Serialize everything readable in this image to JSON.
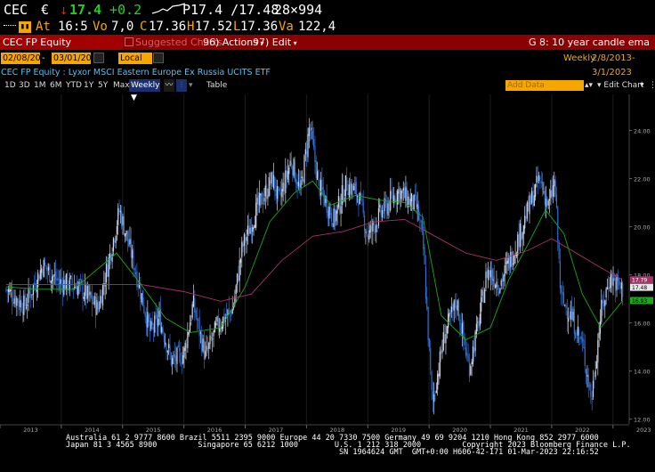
{
  "quote": {
    "ticker": "CEC",
    "currency_symbol": "€",
    "arrow": "↓",
    "last": "17.4",
    "change": "+0.2",
    "bidask": "P17.4 /17.48",
    "size": "28×994",
    "time_label": "At",
    "time": "16:5",
    "vol_label": "Vo",
    "vol": "7,0",
    "open_label": "C",
    "open": "17.36",
    "high_label": "H",
    "high": "17.52",
    "low_label": "L",
    "low": "17.36",
    "val_label": "Va",
    "val": "122,4"
  },
  "toolbar": {
    "security": "CEC FP Equity",
    "suggested": "Suggested Charts",
    "actions": "96) Actions",
    "edit": "97) Edit",
    "function": "G 8: 10 year candle ema"
  },
  "daterow": {
    "start": "02/08/2013",
    "end": "03/01/2023",
    "currency": "Local CCY",
    "period": "Weekly",
    "range": "2/8/2013-3/1/2023"
  },
  "titlerow": {
    "title": "CEC FP Equity : Lyxor MSCI Eastern Europe Ex Russia UCITS ETF",
    "add_data": "Add Data",
    "edit_chart": "Edit Chart"
  },
  "controls": [
    "1D",
    "3D",
    "1M",
    "6M",
    "YTD",
    "1Y",
    "5Y",
    "Max",
    "Weekly ▼",
    "Table"
  ],
  "colors": {
    "accent_orange": "#f7a600",
    "toolbar_red": "#8b0000",
    "candle_up": "#cfd8ea",
    "candle_down": "#2e6fd8",
    "ema_short": "#1aa81a",
    "ema_long": "#a8326a"
  },
  "chart_data": {
    "type": "candlestick",
    "x_axis": [
      "2013",
      "2014",
      "2015",
      "2016",
      "2017",
      "2018",
      "2019",
      "2020",
      "2021",
      "2022",
      "2023"
    ],
    "y_ticks": [
      "12.00",
      "14.00",
      "16.00",
      "18.00",
      "20.00",
      "22.00",
      "24.00"
    ],
    "ylim": [
      11.8,
      25.5
    ],
    "price_path": [
      [
        2013.1,
        17.4
      ],
      [
        2013.4,
        16.7
      ],
      [
        2013.7,
        18.4
      ],
      [
        2013.95,
        17.7
      ],
      [
        2014.3,
        17.5
      ],
      [
        2014.6,
        16.6
      ],
      [
        2014.8,
        18.9
      ],
      [
        2014.95,
        20.7
      ],
      [
        2015.2,
        18.3
      ],
      [
        2015.45,
        15.6
      ],
      [
        2015.6,
        16.2
      ],
      [
        2015.8,
        14.4
      ],
      [
        2016.0,
        14.7
      ],
      [
        2016.15,
        16.8
      ],
      [
        2016.35,
        14.6
      ],
      [
        2016.55,
        15.9
      ],
      [
        2016.8,
        16.6
      ],
      [
        2016.95,
        19.1
      ],
      [
        2017.2,
        20.8
      ],
      [
        2017.45,
        22.0
      ],
      [
        2017.55,
        21.0
      ],
      [
        2017.75,
        22.8
      ],
      [
        2017.9,
        21.4
      ],
      [
        2018.05,
        24.2
      ],
      [
        2018.2,
        21.7
      ],
      [
        2018.45,
        20.3
      ],
      [
        2018.65,
        21.8
      ],
      [
        2018.85,
        21.3
      ],
      [
        2019.0,
        19.6
      ],
      [
        2019.2,
        20.5
      ],
      [
        2019.5,
        21.5
      ],
      [
        2019.8,
        20.8
      ],
      [
        2019.9,
        19.4
      ],
      [
        2020.05,
        12.6
      ],
      [
        2020.25,
        15.5
      ],
      [
        2020.45,
        16.9
      ],
      [
        2020.65,
        14.1
      ],
      [
        2020.8,
        15.9
      ],
      [
        2020.95,
        18.2
      ],
      [
        2021.15,
        17.6
      ],
      [
        2021.4,
        19.1
      ],
      [
        2021.6,
        20.6
      ],
      [
        2021.8,
        22.0
      ],
      [
        2021.95,
        20.8
      ],
      [
        2022.05,
        21.9
      ],
      [
        2022.15,
        17.0
      ],
      [
        2022.3,
        16.4
      ],
      [
        2022.5,
        15.1
      ],
      [
        2022.65,
        12.8
      ],
      [
        2022.8,
        16.4
      ],
      [
        2022.95,
        17.9
      ],
      [
        2023.15,
        17.4
      ]
    ],
    "ema_short_path": [
      [
        2013.1,
        17.5
      ],
      [
        2013.6,
        17.4
      ],
      [
        2014.2,
        17.4
      ],
      [
        2014.9,
        18.9
      ],
      [
        2015.3,
        17.6
      ],
      [
        2015.7,
        16.2
      ],
      [
        2016.1,
        15.6
      ],
      [
        2016.6,
        15.8
      ],
      [
        2017.0,
        17.5
      ],
      [
        2017.4,
        20.2
      ],
      [
        2017.8,
        21.4
      ],
      [
        2018.1,
        21.9
      ],
      [
        2018.4,
        20.9
      ],
      [
        2018.8,
        21.3
      ],
      [
        2019.2,
        21.1
      ],
      [
        2019.6,
        21.0
      ],
      [
        2019.9,
        20.4
      ],
      [
        2020.2,
        16.3
      ],
      [
        2020.6,
        15.3
      ],
      [
        2021.0,
        15.8
      ],
      [
        2021.3,
        17.8
      ],
      [
        2021.6,
        19.2
      ],
      [
        2021.9,
        20.7
      ],
      [
        2022.2,
        19.7
      ],
      [
        2022.5,
        17.2
      ],
      [
        2022.8,
        15.8
      ],
      [
        2023.15,
        16.9
      ]
    ],
    "ema_long_path": [
      [
        2013.1,
        17.6
      ],
      [
        2014.0,
        17.6
      ],
      [
        2014.7,
        17.6
      ],
      [
        2015.3,
        17.6
      ],
      [
        2016.0,
        17.3
      ],
      [
        2016.6,
        16.9
      ],
      [
        2017.1,
        17.2
      ],
      [
        2017.6,
        18.6
      ],
      [
        2018.1,
        19.6
      ],
      [
        2018.6,
        19.8
      ],
      [
        2019.1,
        20.2
      ],
      [
        2019.6,
        20.3
      ],
      [
        2020.1,
        19.6
      ],
      [
        2020.6,
        18.9
      ],
      [
        2021.1,
        18.6
      ],
      [
        2021.6,
        19.0
      ],
      [
        2022.0,
        19.5
      ],
      [
        2022.4,
        18.9
      ],
      [
        2022.8,
        18.3
      ],
      [
        2023.15,
        17.8
      ]
    ],
    "last_labels": {
      "long": "17.79",
      "mid": "17.48",
      "short": "16.93"
    }
  },
  "footer": {
    "line1": "Australia 61 2 9777 8600 Brazil 5511 2395 9000 Europe 44 20 7330 7500 Germany 49 69 9204 1210 Hong Kong 852 2977 6000",
    "line2": "Japan 81 3 4565 8900         Singapore 65 6212 1000        U.S. 1 212 318 2000         Copyright 2023 Bloomberg Finance L.P.",
    "line3": "                                                            SN 1964624 GMT  GMT+0:00 H606-42-171 01-Mar-2023 22:16:52"
  }
}
